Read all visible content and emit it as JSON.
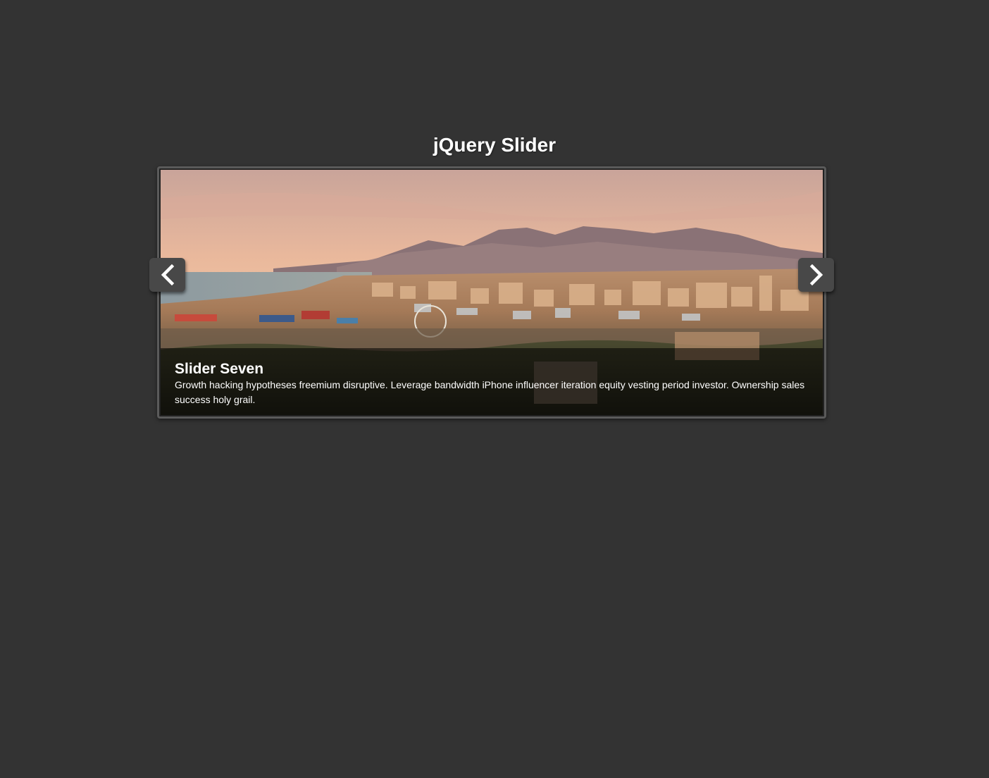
{
  "page": {
    "title": "jQuery Slider"
  },
  "slider": {
    "current_slide": {
      "title": "Slider Seven",
      "description": "Growth hacking hypotheses freemium disruptive. Leverage bandwidth iPhone influencer iteration equity vesting period investor. Ownership sales success holy grail.",
      "image_subject": "city-panorama-sunset"
    },
    "prev_icon": "chevron-left-icon",
    "next_icon": "chevron-right-icon"
  },
  "colors": {
    "background": "#333333",
    "frame_border": "#5a5a5a",
    "nav_button": "#484848",
    "text": "#ffffff"
  }
}
